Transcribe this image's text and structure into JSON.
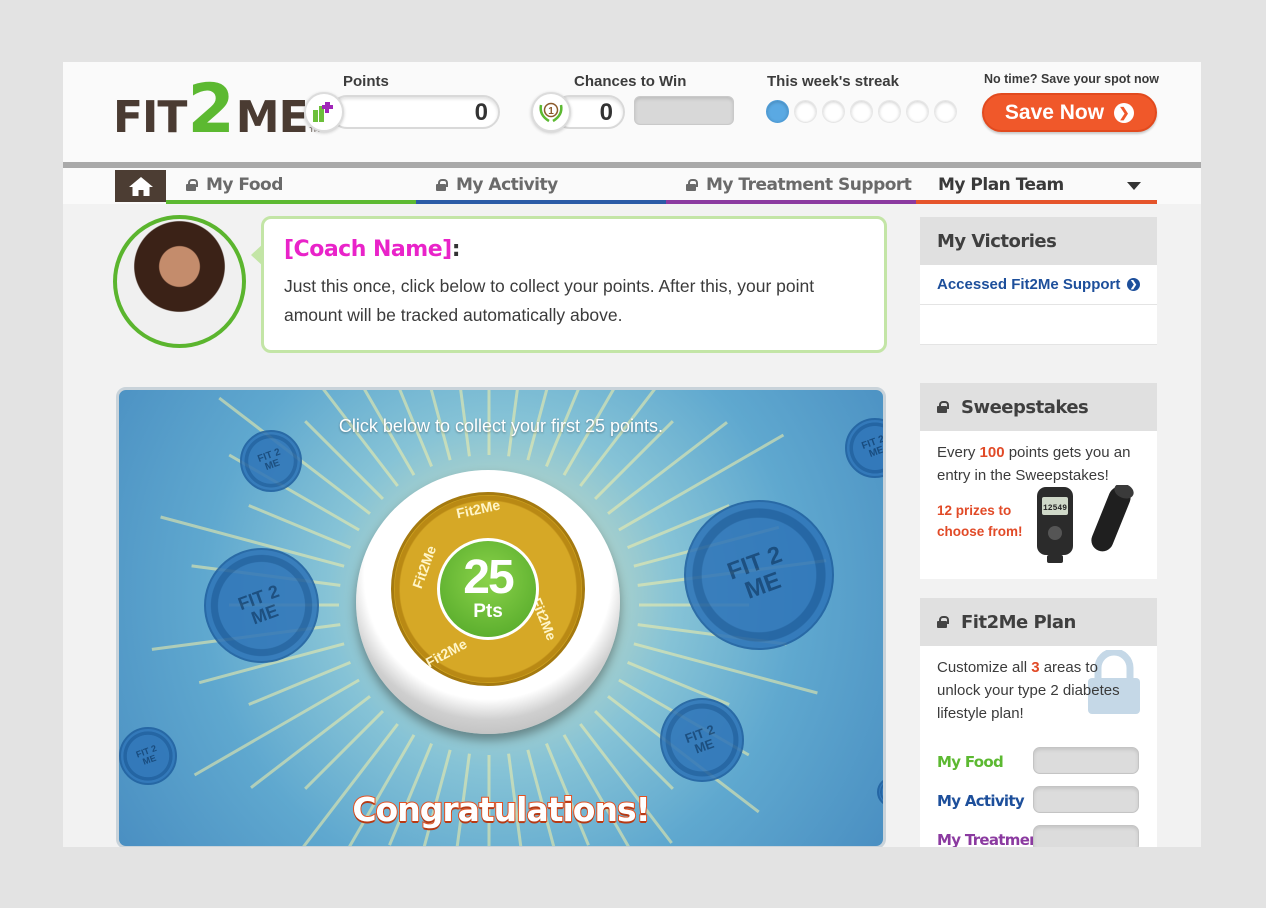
{
  "brand": {
    "logo_left": "FIT",
    "logo_two": "2",
    "logo_right": "ME",
    "logo_tm": "TM"
  },
  "stats": {
    "points_label": "Points",
    "points_value": "0",
    "chances_label": "Chances to Win",
    "chances_value": "0",
    "chances_badge": "1",
    "streak_label": "This week's streak",
    "streak_days_filled": 1,
    "streak_days_total": 7
  },
  "save": {
    "note": "No time? Save your spot now",
    "button_label": "Save Now"
  },
  "nav": {
    "tabs": [
      {
        "label": "My Food",
        "locked": true,
        "color": "#5cb931"
      },
      {
        "label": "My Activity",
        "locked": true,
        "color": "#2a5aa6"
      },
      {
        "label": "My Treatment Support",
        "locked": true,
        "color": "#8b3aa0"
      },
      {
        "label": "My Plan Team",
        "locked": false,
        "color": "#e5542b"
      }
    ]
  },
  "coach": {
    "name": "[Coach Name]",
    "colon": ":",
    "message": "Just this once, click below to collect your points. After this, your point amount will be tracked automatically above."
  },
  "stage": {
    "instruction": "Click below to collect your first 25 points.",
    "button_number": "25",
    "button_unit": "Pts",
    "ring_text": "Fit2Me",
    "coin_text": "FIT 2 ME",
    "congrats": "Congratulations!"
  },
  "sidebar": {
    "victories": {
      "title": "My Victories",
      "items": [
        "Accessed Fit2Me Support"
      ]
    },
    "sweepstakes": {
      "title": "Sweepstakes",
      "text_before": "Every ",
      "points": "100",
      "text_after": " points gets you an entry in the Sweepstakes!",
      "prizes_count": "12 prizes to",
      "prizes_tail": "choose from!",
      "pedometer_readout": "12549"
    },
    "plan": {
      "title": "Fit2Me Plan",
      "text_before": "Customize all ",
      "areas": "3",
      "text_after": " areas to unlock your type 2 diabetes lifestyle plan!",
      "rows": [
        {
          "label": "My Food",
          "color": "#5cb931"
        },
        {
          "label": "My Activity",
          "color": "#1d4f9b"
        },
        {
          "label": "My Treatment",
          "color": "#8b3aa0"
        }
      ]
    }
  },
  "colors": {
    "accent_orange": "#f0582a",
    "brand_green": "#5cb931",
    "link_blue": "#1d4f9b",
    "coach_magenta": "#e923c9"
  }
}
